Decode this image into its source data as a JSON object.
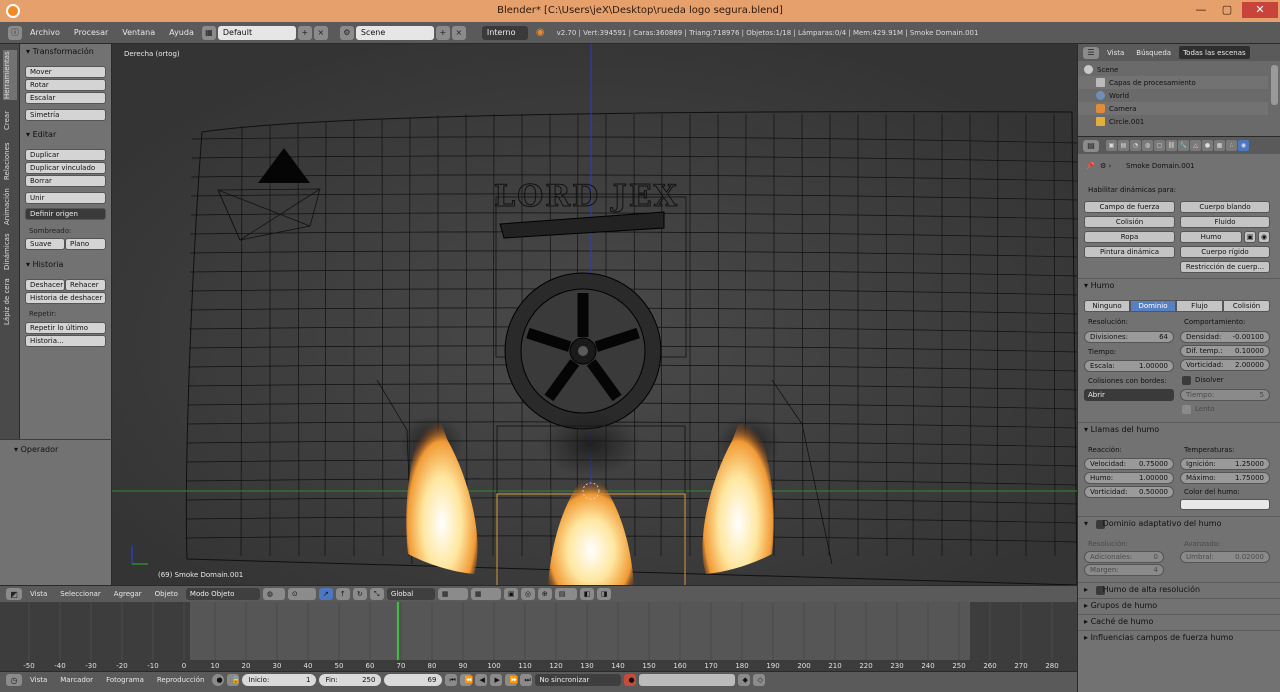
{
  "window": {
    "title": "Blender* [C:\\Users\\jeX\\Desktop\\rueda logo segura.blend]",
    "btn_min": "—",
    "btn_max": "▢",
    "btn_close": "✕"
  },
  "infobar": {
    "menus": [
      "Archivo",
      "Procesar",
      "Ventana",
      "Ayuda"
    ],
    "layout": "Default",
    "scene": "Scene",
    "engine": "Interno",
    "stats": "v2.70 | Vert:394591 | Caras:360869 | Triang:718976 | Objetos:1/18 | Lámparas:0/4 | Mem:429.91M | Smoke Domain.001"
  },
  "toolshelf": {
    "tabs": [
      "Herramientas",
      "Crear",
      "Relaciones",
      "Animación",
      "Dinámicas",
      "Lápiz de cera"
    ],
    "transform_header": "Transformación",
    "transform_buttons": [
      "Mover",
      "Rotar",
      "Escalar"
    ],
    "mirror": "Simetría",
    "edit_header": "Editar",
    "edit_buttons": [
      "Duplicar",
      "Duplicar vinculado",
      "Borrar"
    ],
    "join": "Unir",
    "set_origin": "Definir origen",
    "shading_label": "Sombreado:",
    "smooth": "Suave",
    "flat": "Plano",
    "history_header": "Historia",
    "undo": "Deshacer",
    "redo": "Rehacer",
    "undo_history": "Historia de deshacer",
    "repeat_label": "Repetir:",
    "repeat_last": "Repetir lo último",
    "history_more": "Historia...",
    "operator_header": "Operador"
  },
  "viewport": {
    "view_label": "Derecha (ortog)",
    "object_label": "(69) Smoke Domain.001",
    "logo_text": "LORD JEX"
  },
  "view3d_header": {
    "menus": [
      "Vista",
      "Seleccionar",
      "Agregar",
      "Objeto"
    ],
    "mode": "Modo Objeto",
    "orientation": "Global"
  },
  "timeline": {
    "ticks": [
      "-50",
      "-40",
      "-30",
      "-20",
      "-10",
      "0",
      "10",
      "20",
      "30",
      "40",
      "50",
      "60",
      "70",
      "80",
      "90",
      "100",
      "110",
      "120",
      "130",
      "140",
      "150",
      "160",
      "170",
      "180",
      "190",
      "200",
      "210",
      "220",
      "230",
      "240",
      "250",
      "260",
      "270",
      "280"
    ],
    "menus": [
      "Vista",
      "Marcador",
      "Fotograma",
      "Reproducción"
    ],
    "start_label": "Inicio:",
    "start": "1",
    "end_label": "Fin:",
    "end": "250",
    "current": "69",
    "sync": "No sincronizar"
  },
  "outliner": {
    "tabs": [
      "Vista",
      "Búsqueda",
      "Todas las escenas"
    ],
    "rows": [
      "Scene",
      "Capas de procesamiento",
      "World",
      "Camera",
      "Circle.001"
    ]
  },
  "properties": {
    "object_name": "Smoke Domain.001",
    "dynamics_label": "Habilitar dinámicas para:",
    "dyn_buttons": [
      "Campo de fuerza",
      "Cuerpo blando",
      "Colisión",
      "Fluido",
      "Ropa",
      "Humo",
      "Pintura dinámica",
      "Cuerpo rígido",
      "Restricción de cuerp..."
    ],
    "smoke_header": "Humo",
    "smoke_tabs": [
      "Ninguno",
      "Dominio",
      "Flujo",
      "Colisión"
    ],
    "resolution_label": "Resolución:",
    "divisions_label": "Divisiones:",
    "divisions": "64",
    "time_label": "Tiempo:",
    "scale_label": "Escala:",
    "scale": "1.00000",
    "borders_label": "Colisiones con bordes:",
    "borders_value": "Abrir",
    "behavior_label": "Comportamiento:",
    "density_label": "Densidad:",
    "density": "-0.00100",
    "diff_label": "Dif. temp.:",
    "diff": "0.10000",
    "vorticity_label": "Vorticidad:",
    "vorticity": "2.00000",
    "dissolve": "Disolver",
    "time2_label": "Tiempo:",
    "time2": "5",
    "slow": "Lento",
    "flames_header": "Llamas del humo",
    "reaction_label": "Reacción:",
    "speed_label": "Velocidad:",
    "speed": "0.75000",
    "smoke_label": "Humo:",
    "smoke_val": "1.00000",
    "fvort_label": "Vorticidad:",
    "fvort": "0.50000",
    "temps_label": "Temperaturas:",
    "ignition_label": "Ignición:",
    "ignition": "1.25000",
    "max_label": "Máximo:",
    "max": "1.75000",
    "color_label": "Color del humo:",
    "adaptive_header": "Dominio adaptativo del humo",
    "ad_res_label": "Resolución:",
    "additional_label": "Adicionales:",
    "additional": "0",
    "margin_label": "Margen:",
    "margin": "4",
    "advanced_label": "Avanzado:",
    "threshold_label": "Umbral:",
    "threshold": "0.02000",
    "collapsed": [
      "Humo de alta resolución",
      "Grupos de humo",
      "Caché de humo",
      "Influencias campos de fuerza humo"
    ]
  },
  "colors": {
    "title_bar": "#e6a06c",
    "accent": "#5680c2",
    "flame": "#ffcf6a",
    "bg": "#393939"
  }
}
